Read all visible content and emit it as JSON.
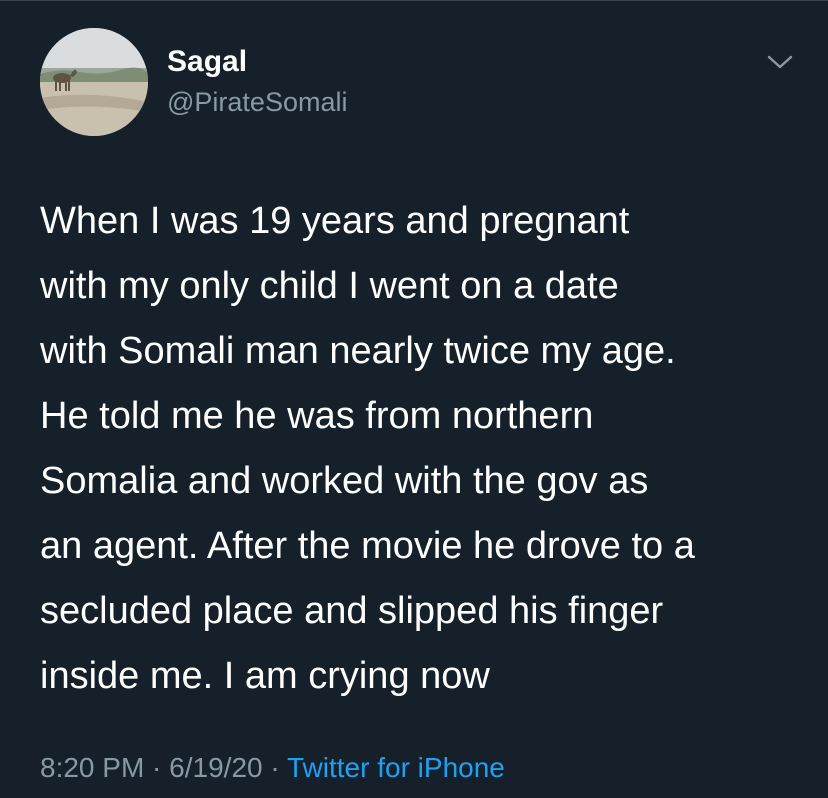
{
  "user": {
    "display_name": "Sagal",
    "handle": "@PirateSomali",
    "avatar_icon": "profile-photo-camel-desert"
  },
  "menu": {
    "icon": "chevron-down-icon"
  },
  "tweet": {
    "lines": [
      "When I was 19 years and pregnant",
      "with my only child I went on a date",
      "with Somali man nearly twice my age.",
      "He told me he was from northern",
      "Somalia and worked with the gov as",
      "an agent. After the movie he drove to a",
      "secluded place and slipped his finger",
      "inside me. I am crying now"
    ]
  },
  "meta": {
    "time": "8:20 PM",
    "separator": " · ",
    "date": "6/19/20",
    "source": "Twitter for iPhone"
  },
  "colors": {
    "background": "#15202b",
    "secondary_text": "#8899a6",
    "link": "#1da1f2"
  }
}
